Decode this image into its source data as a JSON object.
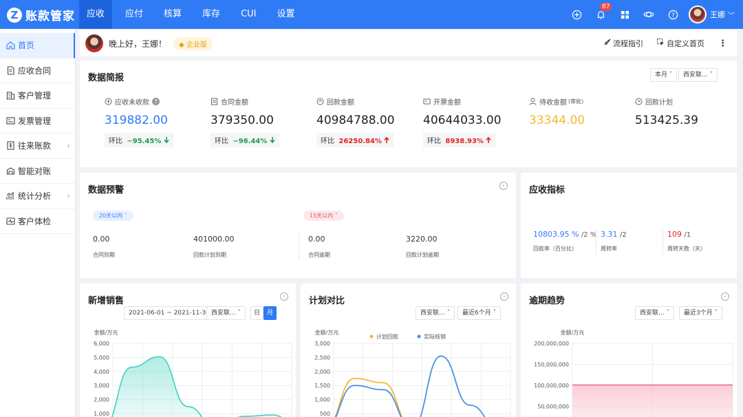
{
  "app": {
    "name": "账款管家",
    "logo_letter": "Z"
  },
  "nav": [
    {
      "label": "应收",
      "active": true
    },
    {
      "label": "应付"
    },
    {
      "label": "核算"
    },
    {
      "label": "库存"
    },
    {
      "label": "CUI"
    },
    {
      "label": "设置"
    }
  ],
  "notification_count": "87",
  "user": {
    "name": "王娜"
  },
  "sidebar": [
    {
      "label": "首页",
      "icon": "home-icon",
      "active": true
    },
    {
      "label": "应收合同",
      "icon": "document-icon"
    },
    {
      "label": "客户管理",
      "icon": "building-icon"
    },
    {
      "label": "发票管理",
      "icon": "invoice-icon"
    },
    {
      "label": "往来账款",
      "icon": "ledger-icon",
      "arrow": "›"
    },
    {
      "label": "智能对账",
      "icon": "reconcile-icon"
    },
    {
      "label": "统计分析",
      "icon": "stats-icon",
      "arrow": "›"
    },
    {
      "label": "客户体检",
      "icon": "checkup-icon"
    }
  ],
  "welcome": {
    "greeting": "晚上好，王娜！",
    "edition": "企业版",
    "guide": "流程指引",
    "customize": "自定义首页"
  },
  "summary": {
    "title": "数据简报",
    "period": "本月",
    "org": "西安联...",
    "kpis": [
      {
        "label": "应收未收款",
        "value": "319882.00",
        "color": "#2f7bf5",
        "cmp_label": "环比",
        "cmp": "−95.45%",
        "dir": "down",
        "help": "?"
      },
      {
        "label": "合同金额",
        "value": "379350.00",
        "color": "#222",
        "cmp_label": "环比",
        "cmp": "−96.44%",
        "dir": "down"
      },
      {
        "label": "回款金额",
        "value": "40984788.00",
        "color": "#222",
        "cmp_label": "环比",
        "cmp": "26250.84%",
        "dir": "up"
      },
      {
        "label": "开票金额",
        "value": "40644033.00",
        "color": "#222",
        "cmp_label": "环比",
        "cmp": "8938.93%",
        "dir": "up"
      },
      {
        "label": "待收金额",
        "sub": "(审批)",
        "value": "33344.00",
        "color": "#f5b82e"
      },
      {
        "label": "回款计划",
        "value": "513425.39",
        "color": "#222"
      }
    ]
  },
  "warning": {
    "title": "数据预警",
    "tag1": "20天以内",
    "tag2": "15天以内",
    "items": [
      {
        "value": "0.00",
        "label": "合同到期"
      },
      {
        "value": "401000.00",
        "label": "回款计划到期"
      },
      {
        "value": "0.00",
        "label": "合同逾期"
      },
      {
        "value": "3220.00",
        "label": "回款计划逾期"
      }
    ]
  },
  "indicators": {
    "title": "应收指标",
    "items": [
      {
        "value": "10803.95 %",
        "suffix": "/2 %",
        "label": "回款率（百分比）",
        "color": "#2f7bf5"
      },
      {
        "value": "3.31",
        "suffix": "/2",
        "label": "周转率",
        "color": "#2f7bf5"
      },
      {
        "value": "109",
        "suffix": "/1",
        "label": "周转天数（天）",
        "color": "#e02424"
      }
    ]
  },
  "sales": {
    "title": "新增销售",
    "date_range": "2021-06-01 ~ 2021-11-30",
    "org": "西安联...",
    "day": "日",
    "month": "月",
    "chart_data": {
      "type": "area",
      "ylabel": "金额/万元",
      "yticks": [
        "6,000",
        "5,000",
        "4,000",
        "3,000",
        "2,000",
        "1,000"
      ],
      "ylim": [
        0,
        6000
      ],
      "series": [
        {
          "values": [
            0,
            4300,
            5050,
            1500,
            0,
            800,
            900,
            0
          ]
        }
      ]
    }
  },
  "plan": {
    "title": "计划对比",
    "org": "西安联...",
    "range": "最近6个月",
    "chart_data": {
      "type": "line",
      "ylabel": "金额/万元",
      "yticks": [
        "3,000",
        "2,500",
        "2,000",
        "1,500",
        "1,000",
        "500"
      ],
      "ylim": [
        0,
        3000
      ],
      "series": [
        {
          "name": "计划回款",
          "color": "#f5b82e",
          "values": [
            0,
            1750,
            1600,
            0,
            0,
            0,
            0
          ]
        },
        {
          "name": "实际核销",
          "color": "#4a90e2",
          "values": [
            0,
            1500,
            1350,
            0,
            2550,
            800,
            0
          ]
        }
      ]
    }
  },
  "overdue": {
    "title": "逾期趋势",
    "org": "西安联...",
    "range": "最近3个月",
    "chart_data": {
      "type": "area",
      "ylabel": "金额/万元",
      "yticks": [
        "200,000,000",
        "150,000,000",
        "100,000,000",
        "50,000,000"
      ],
      "ylim": [
        0,
        200000000
      ],
      "series": [
        {
          "values": [
            101000000,
            101000000,
            101000000
          ]
        }
      ]
    }
  }
}
